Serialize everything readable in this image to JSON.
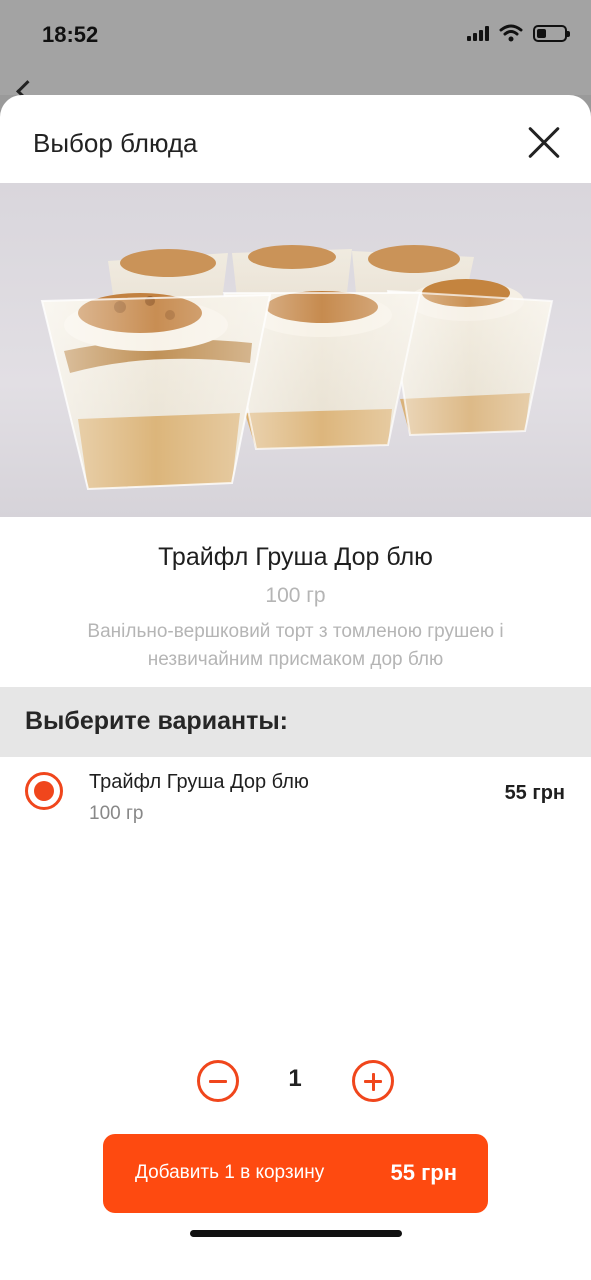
{
  "status_bar": {
    "time": "18:52"
  },
  "sheet": {
    "title": "Выбор блюда"
  },
  "dish": {
    "name": "Трайфл Груша Дор блю",
    "weight": "100 гр",
    "description": "Ванільно-вершковий торт з томленою грушею і незвичайним присмаком дор блю"
  },
  "variants": {
    "title": "Выберите варианты:",
    "items": [
      {
        "name": "Трайфл Груша Дор блю",
        "weight": "100 гр",
        "price": "55 грн",
        "selected": true
      }
    ]
  },
  "quantity": {
    "value": "1"
  },
  "add_button": {
    "label": "Добавить 1 в корзину",
    "price": "55 грн"
  },
  "colors": {
    "accent": "#fe4a10",
    "radio": "#f0461c",
    "muted_text": "#b5b5b5",
    "section_bg": "#e6e6e6"
  },
  "icons": [
    "signal-icon",
    "wifi-icon",
    "battery-icon",
    "close-icon",
    "minus-icon",
    "plus-icon",
    "radio-selected-icon"
  ]
}
